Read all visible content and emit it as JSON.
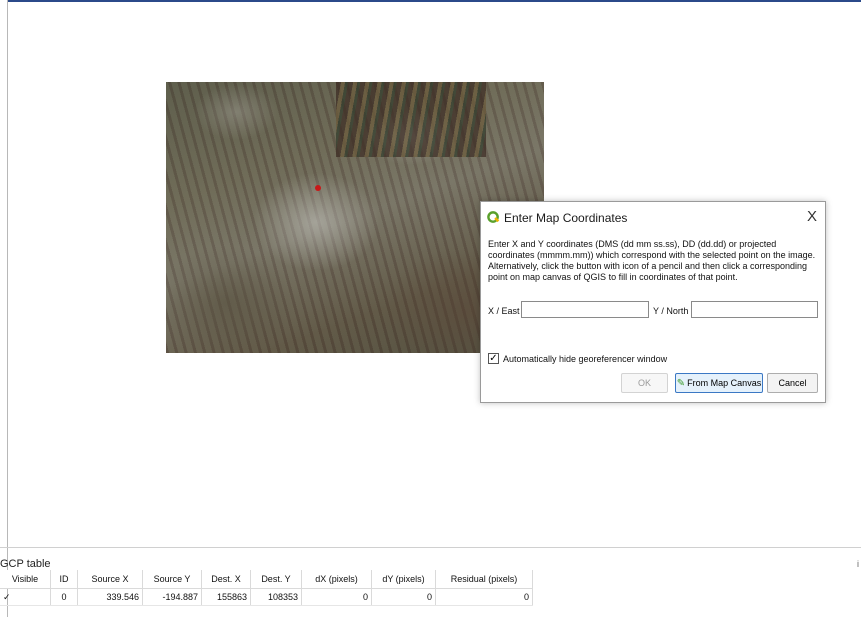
{
  "dialog": {
    "title": "Enter Map Coordinates",
    "close": "X",
    "message": "Enter X and Y coordinates (DMS (dd mm ss.ss), DD (dd.dd) or projected coordinates (mmmm.mm)) which correspond with the selected point on the image. Alternatively, click the button with icon of a pencil and then click a corresponding point on map canvas of QGIS to fill in coordinates of that point.",
    "x_label": "X / East",
    "y_label": "Y / North",
    "x_value": "",
    "y_value": "",
    "checkbox_label": "Automatically hide georeferencer window",
    "checkbox_checked": true,
    "checkbox_mark": "✓",
    "ok_label": "OK",
    "from_canvas_label": "From Map Canvas",
    "cancel_label": "Cancel"
  },
  "gcp": {
    "title": "GCP table",
    "right_marker": "i",
    "headers": [
      "Visible",
      "ID",
      "Source X",
      "Source Y",
      "Dest. X",
      "Dest. Y",
      "dX (pixels)",
      "dY (pixels)",
      "Residual (pixels)"
    ],
    "rows": [
      {
        "visible": "✓",
        "id": "0",
        "source_x": "339.546",
        "source_y": "-194.887",
        "dest_x": "155863",
        "dest_y": "108353",
        "dx": "0",
        "dy": "0",
        "residual": "0"
      }
    ]
  },
  "colors": {
    "accent": "#2b4a8a",
    "gcp_marker": "#c81818",
    "qgis_green": "#5aa02c",
    "qgis_yellow": "#f0b400"
  }
}
